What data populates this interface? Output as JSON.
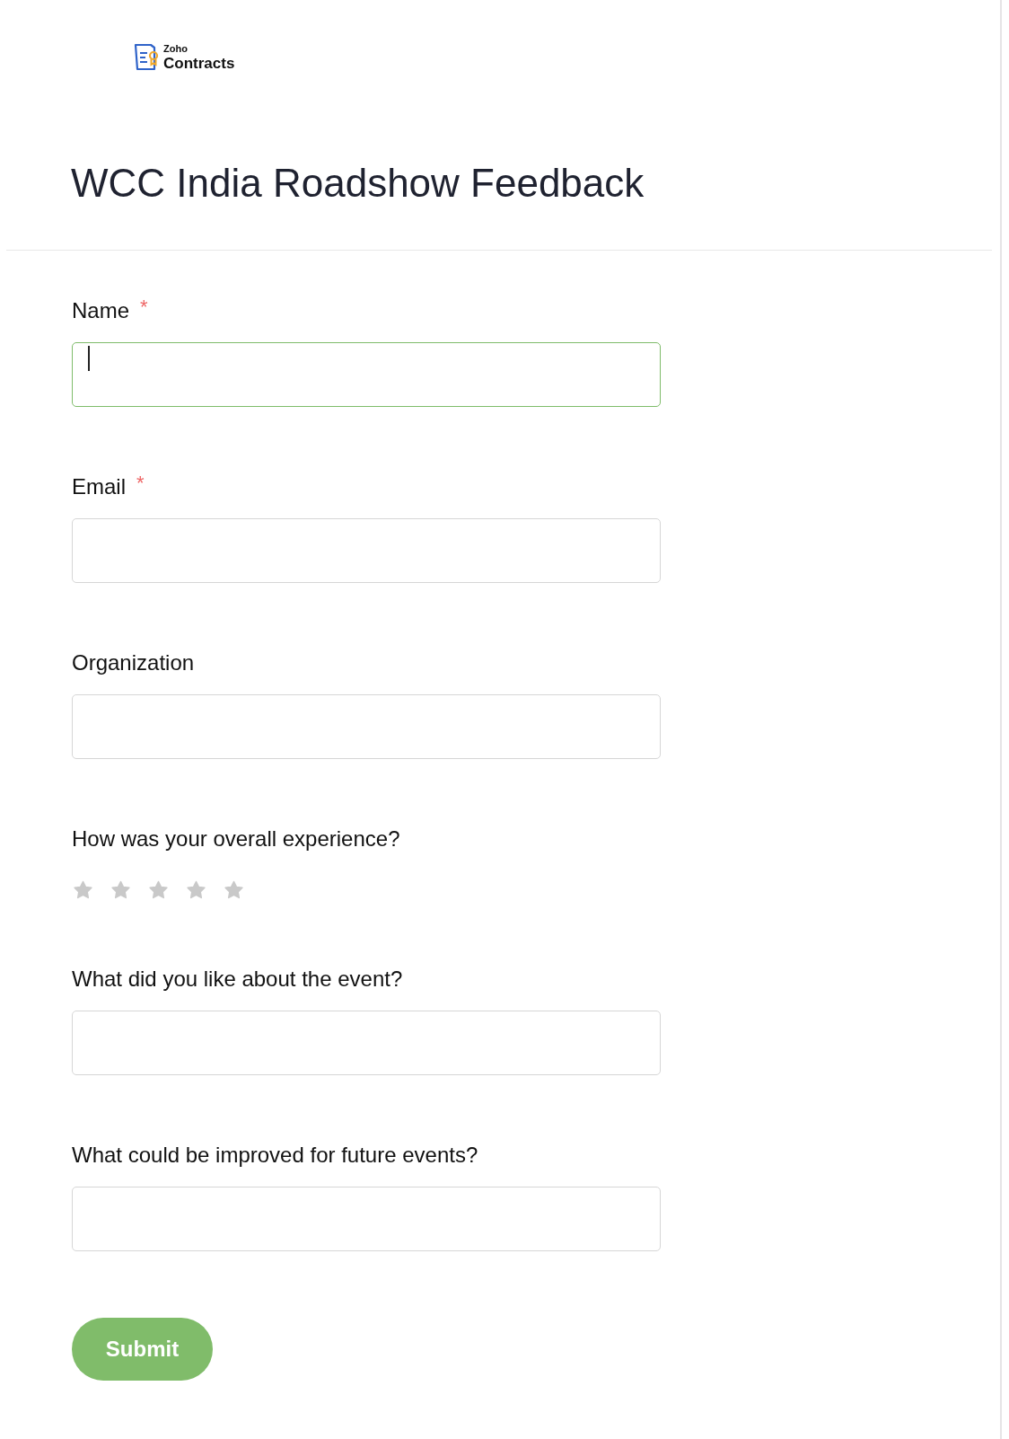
{
  "logo": {
    "small": "Zoho",
    "large": "Contracts"
  },
  "title": "WCC India Roadshow Feedback",
  "fields": [
    {
      "kind": "text",
      "label": "Name",
      "required_mark": "*",
      "focused": true
    },
    {
      "kind": "text",
      "label": "Email",
      "required_mark": "*",
      "focused": false
    },
    {
      "kind": "text",
      "label": "Organization",
      "focused": false
    },
    {
      "kind": "rating",
      "label": "How was your overall experience?",
      "stars": 0
    },
    {
      "kind": "text",
      "label": "What did you like about the event?",
      "focused": false
    },
    {
      "kind": "text",
      "label": "What could be improved for future events?",
      "focused": false
    }
  ],
  "submit": "Submit"
}
